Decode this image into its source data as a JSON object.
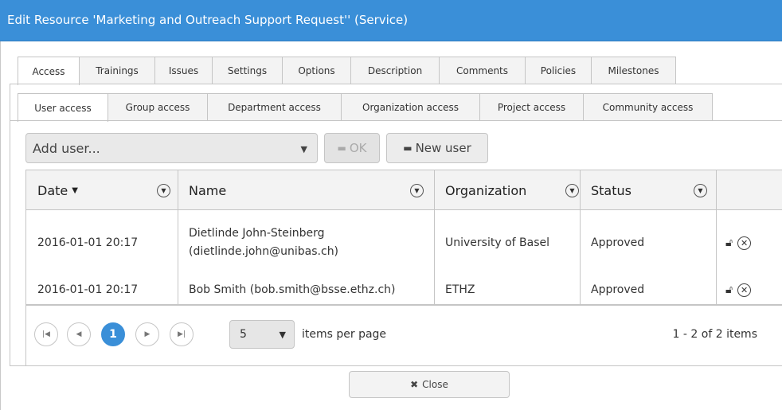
{
  "dialog": {
    "title": "Edit Resource 'Marketing and Outreach Support Request'' (Service)"
  },
  "tabs_main": [
    {
      "label": "Access",
      "active": true
    },
    {
      "label": "Trainings"
    },
    {
      "label": "Issues"
    },
    {
      "label": "Settings"
    },
    {
      "label": "Options"
    },
    {
      "label": "Description"
    },
    {
      "label": "Comments"
    },
    {
      "label": "Policies"
    },
    {
      "label": "Milestones"
    }
  ],
  "tabs_access": [
    {
      "label": "User access",
      "active": true
    },
    {
      "label": "Group access"
    },
    {
      "label": "Department access"
    },
    {
      "label": "Organization access"
    },
    {
      "label": "Project access"
    },
    {
      "label": "Community access"
    }
  ],
  "toolbar": {
    "add_user_placeholder": "Add user...",
    "ok_label": "OK",
    "new_user_label": "New user"
  },
  "grid": {
    "columns": [
      "Date",
      "Name",
      "Organization",
      "Status"
    ],
    "sort_indicator": "▼",
    "rows": [
      {
        "date": "2016-01-01 20:17",
        "name": "Dietlinde John-Steinberg (dietlinde.john@unibas.ch)",
        "organization": "University of Basel",
        "status": "Approved"
      },
      {
        "date": "2016-01-01 20:17",
        "name": "Bob Smith (bob.smith@bsse.ethz.ch)",
        "organization": "ETHZ",
        "status": "Approved"
      }
    ]
  },
  "pager": {
    "current_page": "1",
    "page_size": "5",
    "items_per_page_label": "items per page",
    "info": "1 - 2 of 2 items"
  },
  "footer": {
    "close_label": "Close"
  },
  "colors": {
    "title_bar": "#3a8fd8",
    "pager_active": "#3a8fd8"
  },
  "icons": {
    "lock": "unlock-icon",
    "remove": "remove-icon",
    "filter": "filter-icon"
  }
}
